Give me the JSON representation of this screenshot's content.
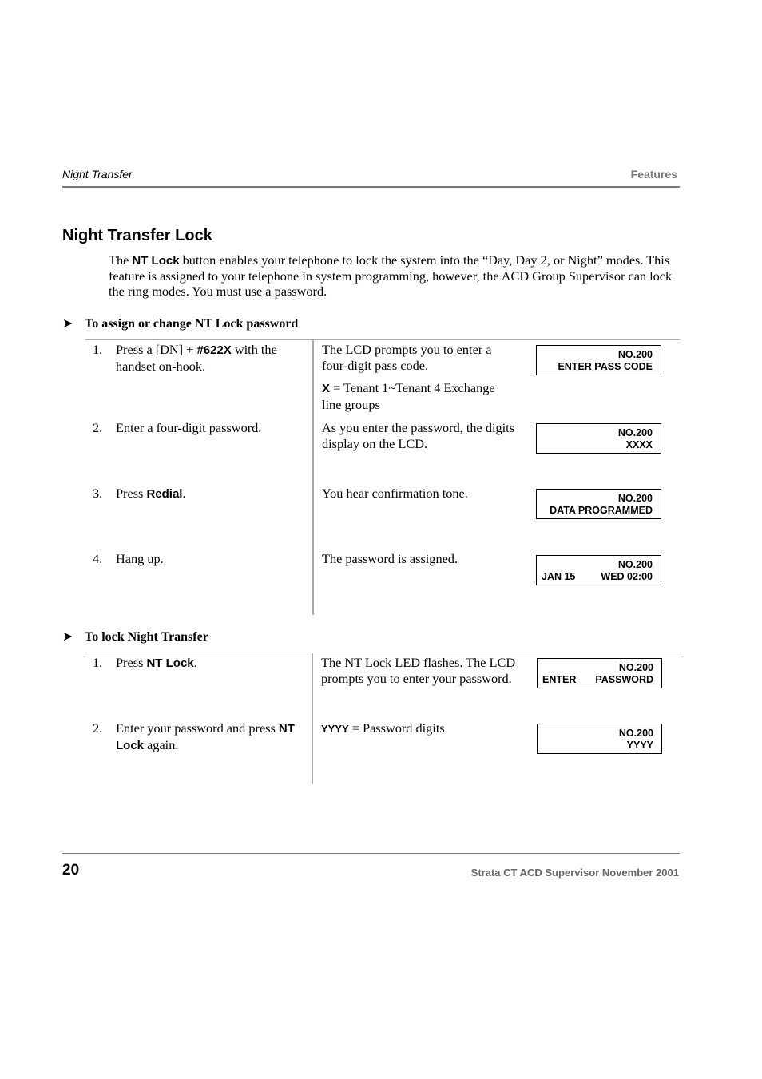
{
  "header": {
    "section": "Night Transfer",
    "chapter": "Features"
  },
  "title": "Night Transfer Lock",
  "intro": {
    "pre": "The ",
    "bold": "NT Lock",
    "post": " button enables your telephone to lock the system into the “Day, Day 2, or Night” modes. This feature is assigned to your telephone in system programming, however,  the ACD Group Supervisor can lock the ring modes. You must use a password."
  },
  "procedures": [
    {
      "heading": "To assign or change NT Lock password",
      "steps": [
        {
          "num": "1.",
          "pre": "Press a [DN] + ",
          "bold": "#622X",
          "post": "  with the handset on-hook.",
          "response": "The LCD prompts you to enter a four-digit pass code.",
          "note_bold": "X",
          "note": " = Tenant 1~Tenant 4 Exchange line groups",
          "lcd": [
            "NO.200",
            "ENTER PASS CODE"
          ]
        },
        {
          "num": "2.",
          "pre": "Enter a four-digit password.",
          "response": "As you enter the password, the digits display on the LCD.",
          "lcd": [
            "NO.200",
            "XXXX"
          ]
        },
        {
          "num": "3.",
          "pre": "Press ",
          "bold": "Redial",
          "post": ".",
          "response": "You hear confirmation tone.",
          "lcd": [
            "NO.200",
            "DATA PROGRAMMED"
          ]
        },
        {
          "num": "4.",
          "pre": "Hang up.",
          "response": "The password is assigned.",
          "lcd": [
            "NO.200",
            "JAN 15",
            "WED 02:00"
          ]
        }
      ]
    },
    {
      "heading": "To lock Night Transfer",
      "steps": [
        {
          "num": "1.",
          "pre": "Press ",
          "bold": "NT Lock",
          "post": ".",
          "response": "The NT Lock LED flashes. The LCD prompts you to enter your password.",
          "lcd": [
            "NO.200",
            "ENTER",
            "PASSWORD"
          ]
        },
        {
          "num": "2.",
          "pre": "Enter your password and press ",
          "bold": "NT Lock",
          "post": " again.",
          "response_bold": "YYYY",
          "response": " = Password digits",
          "lcd": [
            "NO.200",
            "YYYY"
          ]
        }
      ]
    }
  ],
  "footer": {
    "page_number": "20",
    "doc_title": "Strata CT ACD Supervisor  November 2001"
  }
}
